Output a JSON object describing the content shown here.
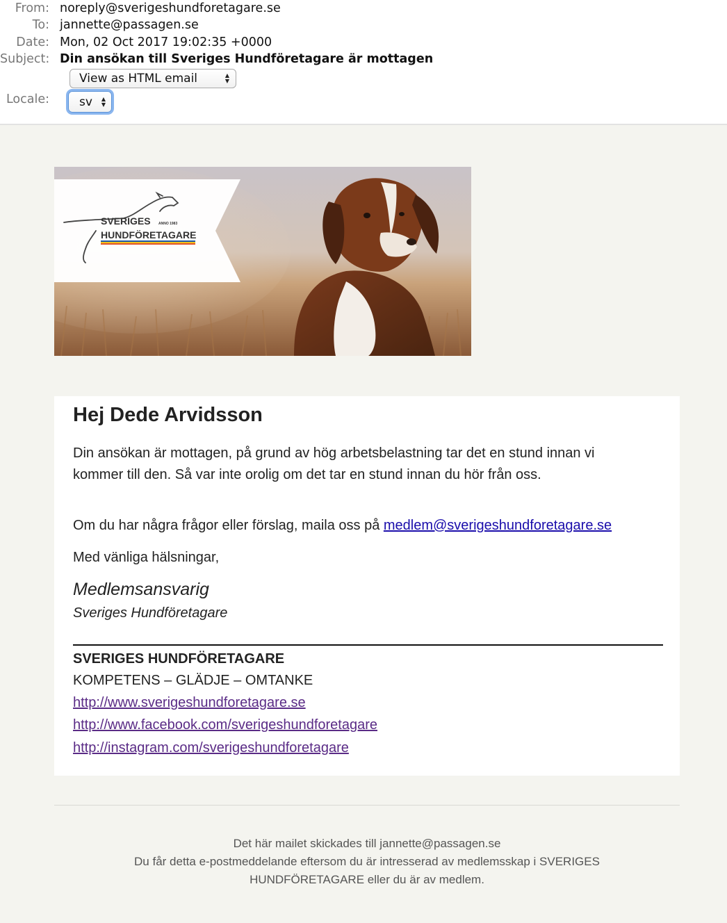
{
  "header": {
    "from_label": "From:",
    "from": "noreply@sverigeshundforetagare.se",
    "to_label": "To:",
    "to": "jannette@passagen.se",
    "date_label": "Date:",
    "date": "Mon, 02 Oct 2017 19:02:35 +0000",
    "subject_label": "Subject:",
    "subject": "Din ansökan till Sveriges Hundföretagare är mottagen",
    "view_select": "View as HTML email",
    "locale_label": "Locale:",
    "locale_select": "sv"
  },
  "banner": {
    "logo_line1": "SVERIGES",
    "logo_anno": "ANNO 1983",
    "logo_line2": "HUNDFÖRETAGARE",
    "stripe_colors": [
      "#1d5aa8",
      "#f2c21a",
      "#e2552b"
    ]
  },
  "message": {
    "greeting": "Hej Dede Arvidsson",
    "paragraph1": "Din ansökan är mottagen, på grund av hög arbetsbelastning tar det en stund innan vi kommer till den. Så var inte orolig om det tar en stund innan du hör från oss.",
    "questions_text": "Om du har några frågor eller förslag, maila oss på ",
    "questions_email": "medlem@sverigeshundforetagare.se",
    "closing": "Med vänliga hälsningar,",
    "signature_role": "Medlemsansvarig",
    "signature_org": "Sveriges Hundföretagare",
    "org_name": "SVERIGES HUNDFÖRETAGARE",
    "motto": "KOMPETENS – GLÄDJE – OMTANKE",
    "links": [
      "http://www.sverigeshundforetagare.se",
      "http://www.facebook.com/sverigeshundforetagare",
      "http://instagram.com/sverigeshundforetagare"
    ]
  },
  "footer": {
    "line1": "Det här mailet skickades till jannette@passagen.se",
    "line2": "Du får detta e-postmeddelande eftersom du är intresserad av medlemsskap i SVERIGES HUNDFÖRETAGARE eller du är av medlem."
  }
}
